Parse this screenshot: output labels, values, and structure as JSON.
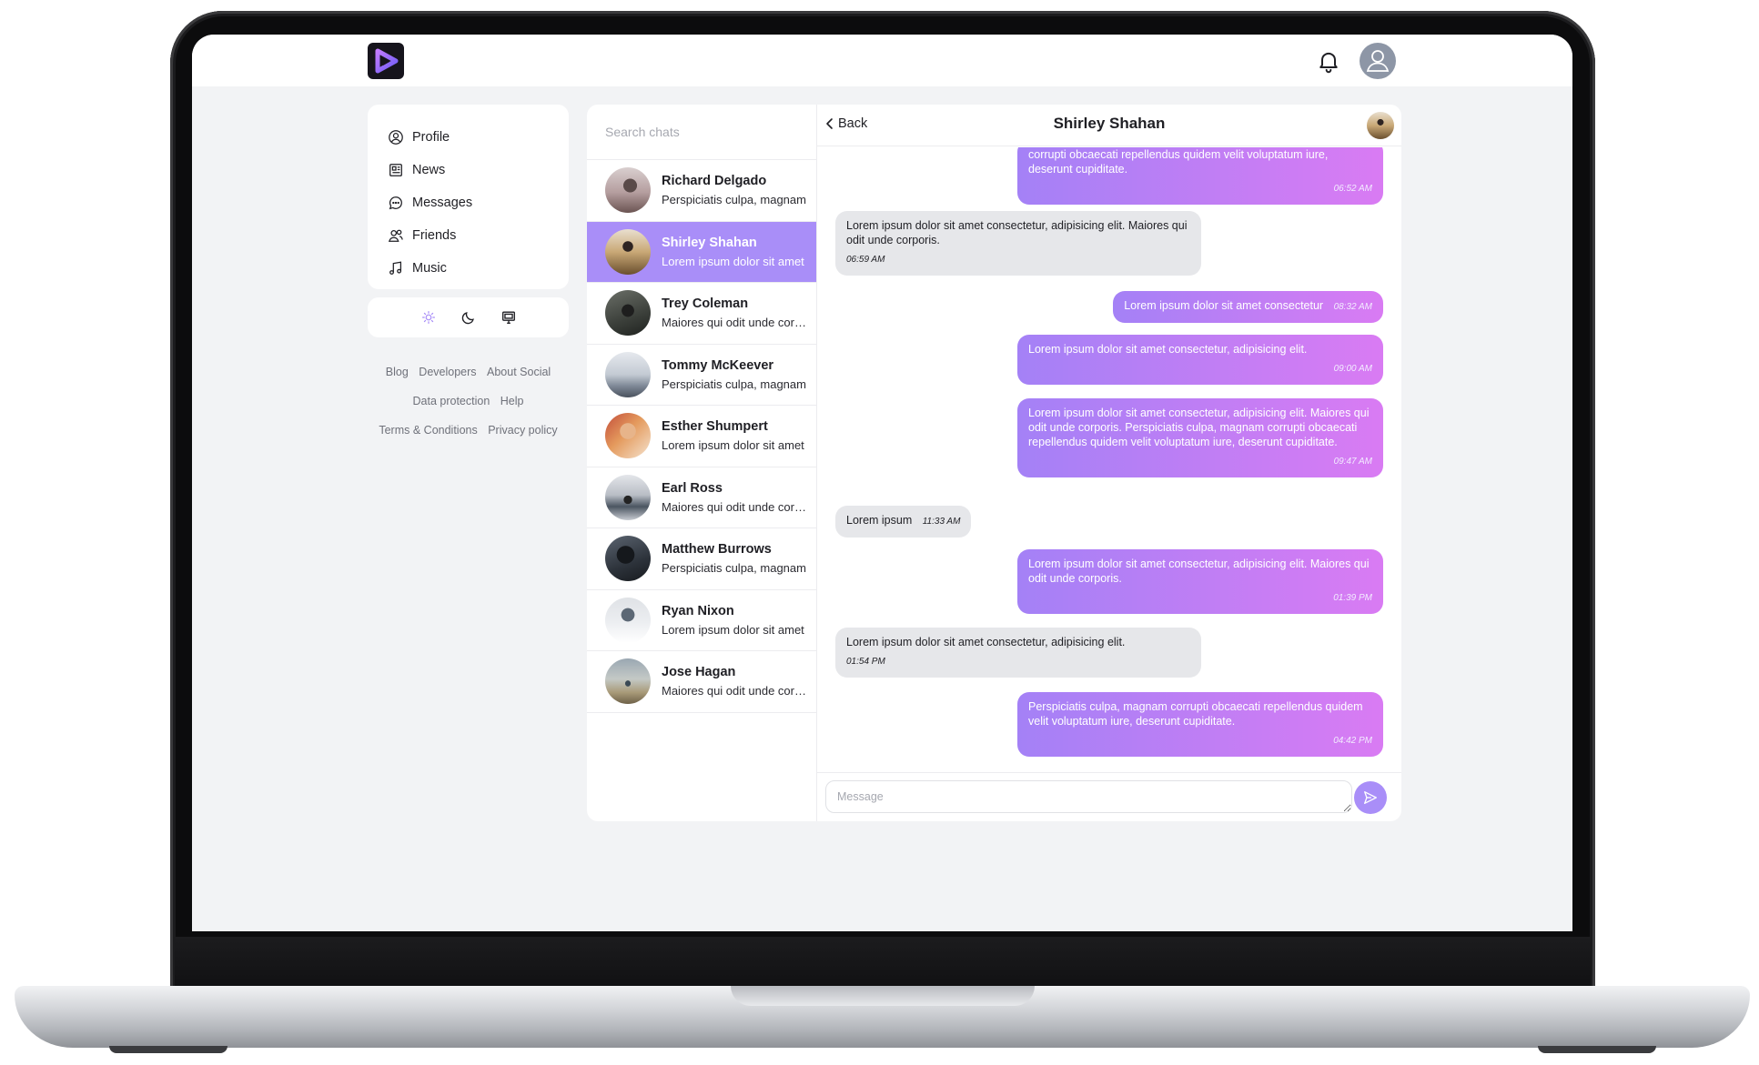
{
  "header": {
    "logo": "play-logo-icon",
    "notification_icon": "bell-icon",
    "avatar_icon": "user-icon"
  },
  "sidebar": {
    "items": [
      {
        "label": "Profile",
        "icon": "user-circle-icon"
      },
      {
        "label": "News",
        "icon": "newspaper-icon"
      },
      {
        "label": "Messages",
        "icon": "chat-bubble-icon"
      },
      {
        "label": "Friends",
        "icon": "friends-icon"
      },
      {
        "label": "Music",
        "icon": "music-note-icon"
      }
    ],
    "theme_options": [
      {
        "name": "light",
        "icon": "sun-icon",
        "active": true
      },
      {
        "name": "dark",
        "icon": "moon-icon"
      },
      {
        "name": "system",
        "icon": "monitor-icon"
      }
    ],
    "footer_links": [
      [
        "Blog",
        "Developers",
        "About Social"
      ],
      [
        "Data protection",
        "Help"
      ],
      [
        "Terms & Conditions",
        "Privacy policy"
      ]
    ]
  },
  "chat_list": {
    "search_placeholder": "Search chats",
    "active_index": 1,
    "chats": [
      {
        "name": "Richard Delgado",
        "preview": "Perspiciatis culpa, magnam"
      },
      {
        "name": "Shirley Shahan",
        "preview": "Lorem ipsum dolor sit amet"
      },
      {
        "name": "Trey Coleman",
        "preview": "Maiores qui odit unde corporis"
      },
      {
        "name": "Tommy McKeever",
        "preview": "Perspiciatis culpa, magnam"
      },
      {
        "name": "Esther Shumpert",
        "preview": "Lorem ipsum dolor sit amet"
      },
      {
        "name": "Earl Ross",
        "preview": "Maiores qui odit unde corporis"
      },
      {
        "name": "Matthew Burrows",
        "preview": "Perspiciatis culpa, magnam"
      },
      {
        "name": "Ryan Nixon",
        "preview": "Lorem ipsum dolor sit amet"
      },
      {
        "name": "Jose Hagan",
        "preview": "Maiores qui odit unde corporis"
      }
    ]
  },
  "conversation": {
    "back_label": "Back",
    "title": "Shirley Shahan",
    "messages": [
      {
        "dir": "out",
        "text": "corrupti obcaecati repellendus quidem velit voluptatum iure, deserunt cupiditate.",
        "time": "06:52 AM"
      },
      {
        "dir": "in",
        "text": "Lorem ipsum dolor sit amet consectetur, adipisicing elit. Maiores qui odit unde corporis.",
        "time": "06:59 AM"
      },
      {
        "dir": "out",
        "text": "Lorem ipsum dolor sit amet consectetur",
        "time": "08:32 AM"
      },
      {
        "dir": "out",
        "text": "Lorem ipsum dolor sit amet consectetur, adipisicing elit.",
        "time": "09:00 AM"
      },
      {
        "dir": "out",
        "text": "Lorem ipsum dolor sit amet consectetur, adipisicing elit. Maiores qui odit unde corporis. Perspiciatis culpa, magnam corrupti obcaecati repellendus quidem velit voluptatum iure, deserunt cupiditate.",
        "time": "09:47 AM"
      },
      {
        "dir": "in",
        "text": "Lorem ipsum",
        "time": "11:33 AM"
      },
      {
        "dir": "out",
        "text": "Lorem ipsum dolor sit amet consectetur, adipisicing elit. Maiores qui odit unde corporis.",
        "time": "01:39 PM"
      },
      {
        "dir": "in",
        "text": "Lorem ipsum dolor sit amet consectetur, adipisicing elit.",
        "time": "01:54 PM"
      },
      {
        "dir": "out",
        "text": "Perspiciatis culpa, magnam corrupti obcaecati repellendus quidem velit voluptatum iure, deserunt cupiditate.",
        "time": "04:42 PM"
      }
    ],
    "composer_placeholder": "Message",
    "send_icon": "send-icon"
  },
  "colors": {
    "accent": "#a98ef8",
    "bubble_gradient_start": "#a481f6",
    "bubble_gradient_end": "#d97bf3",
    "incoming_bubble": "#e6e7ea",
    "page_bg": "#f2f3f5"
  }
}
